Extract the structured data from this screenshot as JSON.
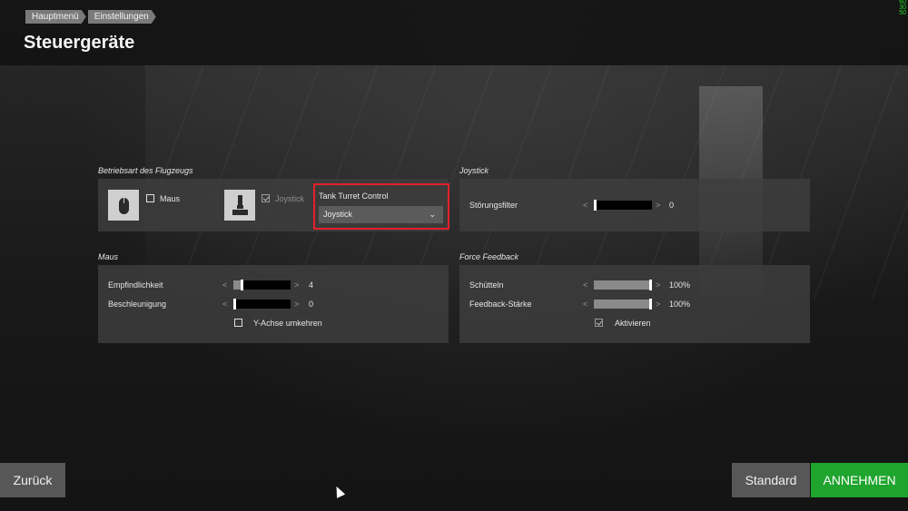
{
  "breadcrumb": [
    "Hauptmenü",
    "Einstellungen"
  ],
  "page_title": "Steuergeräte",
  "corner_stats": [
    "60",
    "30",
    "50"
  ],
  "sections": {
    "flight_mode": {
      "title": "Betriebsart des Flugzeugs",
      "mouse_label": "Maus",
      "mouse_checked": false,
      "joystick_label": "Joystick",
      "joystick_checked": true,
      "tank_turret": {
        "label": "Tank Turret Control",
        "value": "Joystick"
      }
    },
    "joystick": {
      "title": "Joystick",
      "noise_filter": {
        "label": "Störungsfilter",
        "value": "0",
        "fraction": 0.0
      }
    },
    "mouse": {
      "title": "Maus",
      "sensitivity": {
        "label": "Empfindlichkeit",
        "value": "4",
        "fraction": 0.15
      },
      "acceleration": {
        "label": "Beschleunigung",
        "value": "0",
        "fraction": 0.0
      },
      "invert_y": {
        "label": "Y-Achse umkehren",
        "checked": false
      }
    },
    "force_feedback": {
      "title": "Force Feedback",
      "shake": {
        "label": "Schütteln",
        "value": "100%",
        "fraction": 1.0
      },
      "strength": {
        "label": "Feedback-Stärke",
        "value": "100%",
        "fraction": 1.0
      },
      "enable": {
        "label": "Aktivieren",
        "checked": true
      }
    }
  },
  "buttons": {
    "back": "Zurück",
    "default": "Standard",
    "accept": "ANNEHMEN"
  },
  "colors": {
    "accent_accept": "#1fa42e",
    "highlight_border": "#e5202a"
  }
}
